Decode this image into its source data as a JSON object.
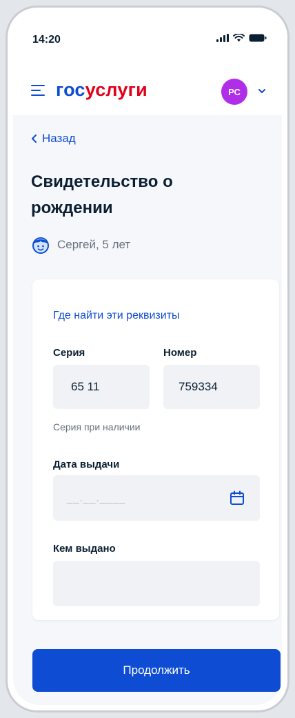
{
  "status_bar": {
    "time": "14:20"
  },
  "header": {
    "logo_part1": "гос",
    "logo_part2": "услуги",
    "avatar_initials": "РС"
  },
  "nav": {
    "back_label": "Назад"
  },
  "page": {
    "title": "Свидетельство о рождении",
    "person": "Сергей, 5 лет"
  },
  "form": {
    "help_link": "Где найти эти реквизиты",
    "series_label": "Серия",
    "series_value": "65 11",
    "number_label": "Номер",
    "number_value": "759334",
    "series_hint": "Серия при наличии",
    "issue_date_label": "Дата выдачи",
    "issue_date_placeholder": "__.__.____",
    "issued_by_label": "Кем выдано",
    "issued_by_value": ""
  },
  "actions": {
    "continue_label": "Продолжить"
  },
  "colors": {
    "brand_blue": "#0d4cd3",
    "brand_red": "#e3001b",
    "avatar_purple": "#b12ee8",
    "field_bg": "#f0f2f5"
  },
  "icons": [
    "menu-icon",
    "chevron-down-icon",
    "chevron-left-icon",
    "child-face-icon",
    "calendar-icon",
    "signal-icon",
    "wifi-icon",
    "battery-icon"
  ]
}
